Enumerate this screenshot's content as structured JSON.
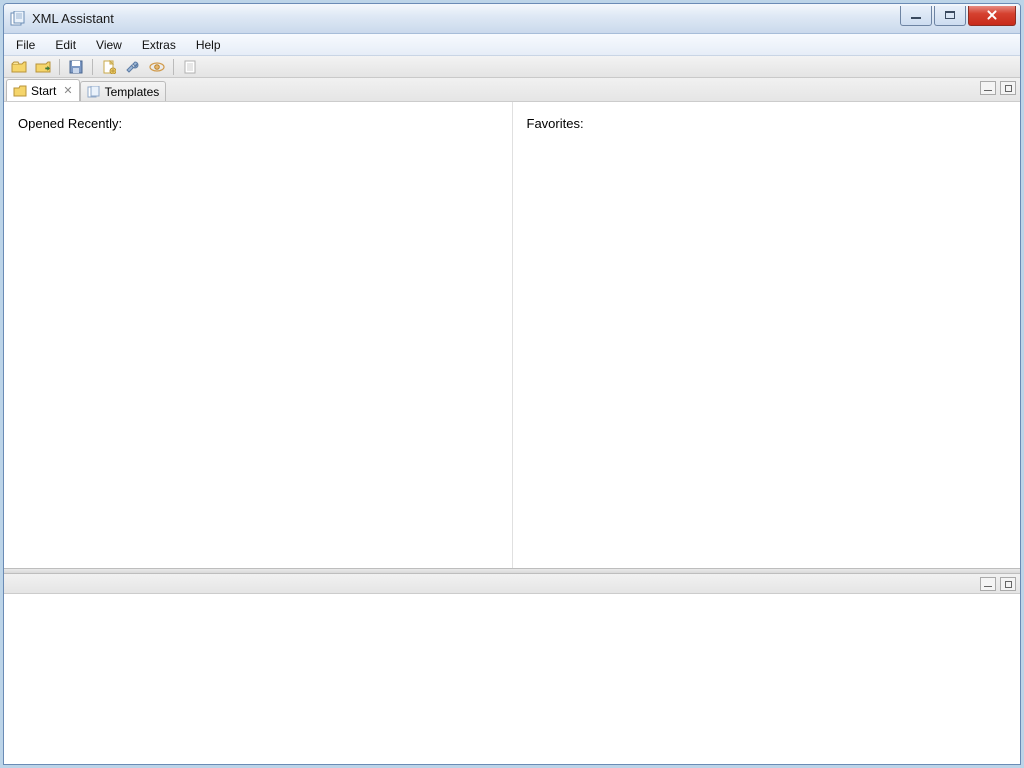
{
  "window": {
    "title": "XML Assistant"
  },
  "menu": {
    "items": [
      "File",
      "Edit",
      "View",
      "Extras",
      "Help"
    ]
  },
  "toolbar": {
    "icons": [
      {
        "name": "open-folder-icon"
      },
      {
        "name": "open-folder-with-arrow-icon"
      },
      {
        "name": "separator"
      },
      {
        "name": "save-icon"
      },
      {
        "name": "separator"
      },
      {
        "name": "new-document-icon"
      },
      {
        "name": "wrench-icon"
      },
      {
        "name": "eye-icon"
      },
      {
        "name": "separator"
      },
      {
        "name": "page-icon"
      }
    ]
  },
  "tabs": {
    "active": {
      "label": "Start",
      "closable": true
    },
    "others": [
      {
        "label": "Templates",
        "closable": false
      }
    ]
  },
  "panes": {
    "recent_heading": "Opened Recently:",
    "favorites_heading": "Favorites:"
  },
  "colors": {
    "titlebar_text": "#1a1a1a",
    "close_btn": "#c82a1a",
    "frame_border": "#6a8bb5"
  }
}
